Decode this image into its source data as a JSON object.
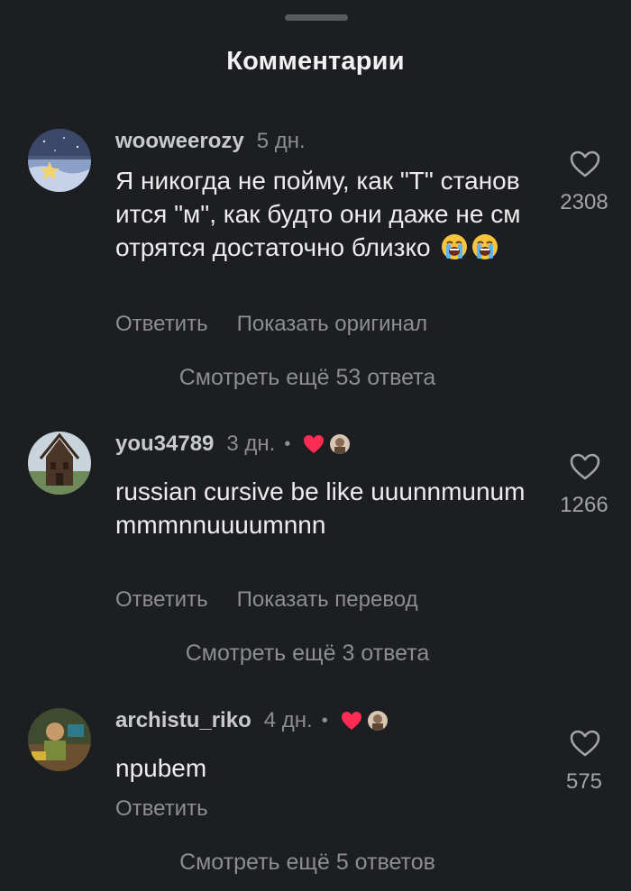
{
  "sheet": {
    "title": "Комментарии"
  },
  "comments": [
    {
      "username": "wooweerozy",
      "time": "5 дн.",
      "text": "Я никогда не пойму, как \"Т\" становится \"м\", как будто они даже не смотрятся достаточно близко",
      "emojis": [
        "loudly-crying-face",
        "loudly-crying-face"
      ],
      "like_count": "2308",
      "actions": [
        "Ответить",
        "Показать оригинал"
      ],
      "more_replies": "Смотреть ещё 53 ответа",
      "creator_liked": false
    },
    {
      "username": "you34789",
      "time": "3 дн.",
      "separator": "•",
      "text": "russian cursive be like uuunnmunummmmnnuuuumnnn",
      "like_count": "1266",
      "actions": [
        "Ответить",
        "Показать перевод"
      ],
      "more_replies": "Смотреть ещё 3 ответа",
      "creator_liked": true
    },
    {
      "username": "archistu_riko",
      "time": "4 дн.",
      "separator": "•",
      "text": "npubem",
      "like_count": "575",
      "actions": [
        "Ответить"
      ],
      "more_replies": "Смотреть ещё 5 ответов",
      "creator_liked": true
    }
  ],
  "icons": {
    "like": "heart-outline-icon",
    "creator_like": "heart-filled-icon",
    "emoji": "loudly-crying-face"
  },
  "colors": {
    "background": "#1d1e21",
    "creator_heart": "#fe2c55"
  }
}
